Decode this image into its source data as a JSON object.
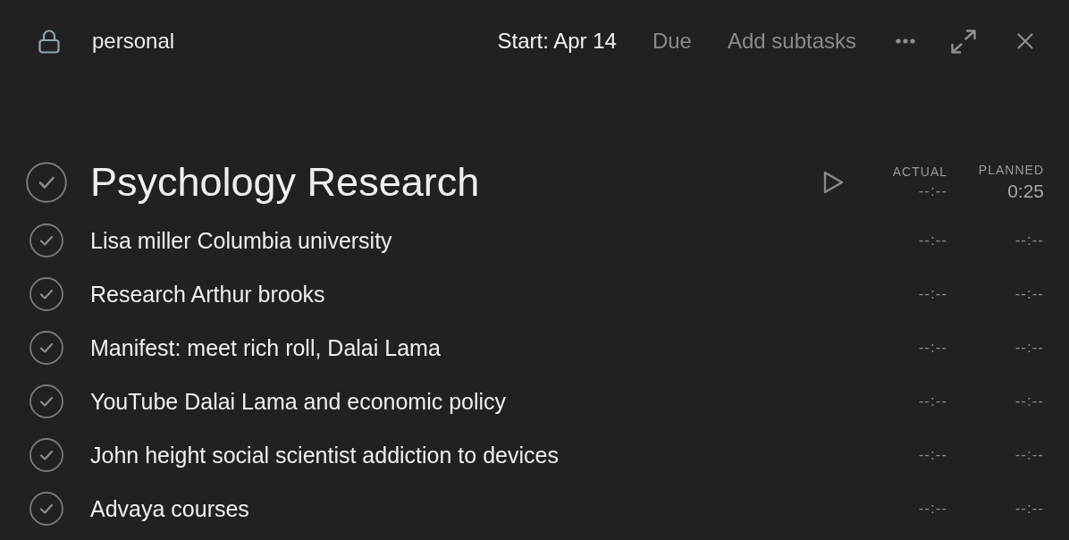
{
  "header": {
    "list": "personal",
    "start": {
      "label": "Start: Apr 14",
      "set": true
    },
    "due": {
      "label": "Due",
      "set": false
    },
    "add_subtasks": "Add subtasks"
  },
  "task": {
    "title": "Psychology Research",
    "done": false,
    "columns": [
      "ACTUAL",
      "PLANNED"
    ],
    "actual": "--:--",
    "planned": "0:25"
  },
  "subtasks": [
    {
      "title": "Lisa miller Columbia university",
      "done": false,
      "actual": "--:--",
      "planned": "--:--"
    },
    {
      "title": "Research Arthur brooks",
      "done": false,
      "actual": "--:--",
      "planned": "--:--"
    },
    {
      "title": "Manifest: meet rich roll, Dalai Lama",
      "done": false,
      "actual": "--:--",
      "planned": "--:--"
    },
    {
      "title": "YouTube Dalai Lama and economic policy",
      "done": false,
      "actual": "--:--",
      "planned": "--:--"
    },
    {
      "title": "John height social scientist addiction to devices",
      "done": false,
      "actual": "--:--",
      "planned": "--:--"
    },
    {
      "title": "Advaya courses",
      "done": false,
      "actual": "--:--",
      "planned": "--:--"
    }
  ]
}
